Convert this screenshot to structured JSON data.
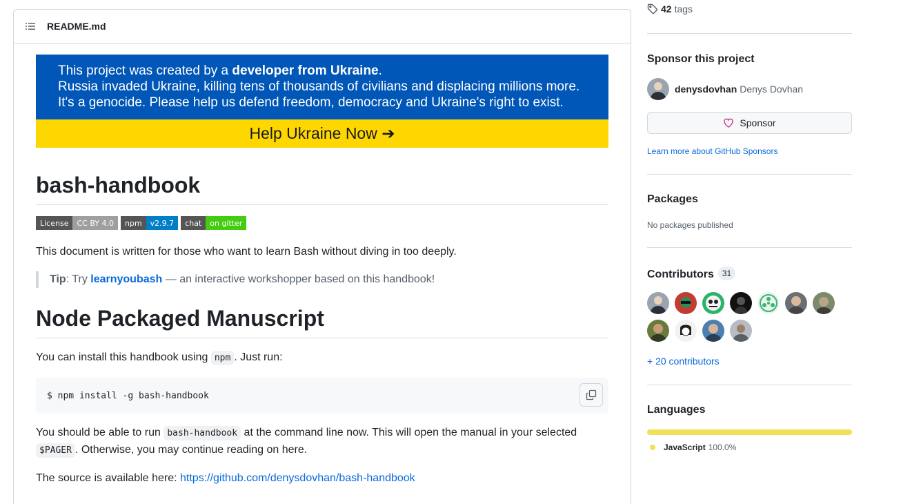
{
  "readme": {
    "filename": "README.md",
    "banner": {
      "line1_pre": "This project was created by a ",
      "line1_bold": "developer from Ukraine",
      "line1_post": ".",
      "line2": "Russia invaded Ukraine, killing tens of thousands of civilians and displacing millions more.",
      "line3": "It's a genocide. Please help us defend freedom, democracy and Ukraine's right to exist.",
      "cta": "Help Ukraine Now ➔",
      "colors": {
        "blue": "#0057b7",
        "yellow": "#ffd700"
      }
    },
    "title": "bash-handbook",
    "badges": [
      {
        "left": "License",
        "right": "CC BY 4.0",
        "color": "#9f9f9f"
      },
      {
        "left": "npm",
        "right": "v2.9.7",
        "color": "#007ec6"
      },
      {
        "left": "chat",
        "right": "on gitter",
        "color": "#44cc11"
      }
    ],
    "intro": "This document is written for those who want to learn Bash without diving in too deeply.",
    "tip": {
      "label": "Tip",
      "pre": ": Try ",
      "link": "learnyoubash",
      "post": " — an interactive workshopper based on this handbook!"
    },
    "section_title": "Node Packaged Manuscript",
    "install_pre": "You can install this handbook using ",
    "install_code": "npm",
    "install_post": ". Just run:",
    "command": "$ npm install -g bash-handbook",
    "run_pre": "You should be able to run ",
    "run_code": "bash-handbook",
    "run_mid": " at the command line now. This will open the manual in your selected",
    "run_code2": "$PAGER",
    "run_post": ". Otherwise, you may continue reading on here.",
    "source_pre": "The source is available here: ",
    "source_link": "https://github.com/denysdovhan/bash-handbook"
  },
  "sidebar": {
    "tags_count": "42",
    "tags_label": "tags",
    "sponsor": {
      "heading": "Sponsor this project",
      "login": "denysdovhan",
      "name": "Denys Dovhan",
      "button": "Sponsor",
      "learn_more": "Learn more about GitHub Sponsors"
    },
    "packages": {
      "heading": "Packages",
      "empty": "No packages published"
    },
    "contributors": {
      "heading": "Contributors",
      "count": "31",
      "more": "+ 20 contributors"
    },
    "languages": {
      "heading": "Languages",
      "items": [
        {
          "name": "JavaScript",
          "percent": "100.0%",
          "color": "#f1e05a"
        }
      ]
    }
  }
}
